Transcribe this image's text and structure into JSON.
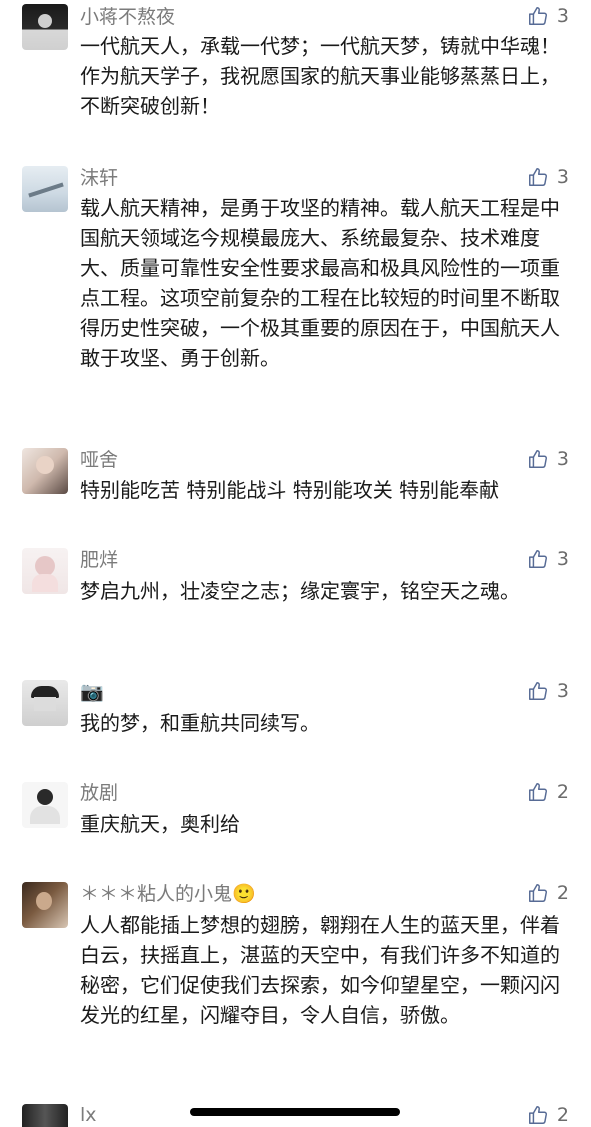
{
  "accent": "#576b95",
  "comments": [
    {
      "name": "小蒋不熬夜",
      "likes": "3",
      "text": "一代航天人，承载一代梦；一代航天梦，铸就中华魂！作为航天学子，我祝愿国家的航天事业能够蒸蒸日上，不断突破创新！"
    },
    {
      "name": "沫轩",
      "likes": "3",
      "text": "载人航天精神，是勇于攻坚的精神。载人航天工程是中国航天领域迄今规模最庞大、系统最复杂、技术难度大、质量可靠性安全性要求最高和极具风险性的一项重点工程。这项空前复杂的工程在比较短的时间里不断取得历史性突破，一个极其重要的原因在于，中国航天人敢于攻坚、勇于创新。"
    },
    {
      "name": "哑舍",
      "likes": "3",
      "text": "特别能吃苦 特别能战斗 特别能攻关 特别能奉献"
    },
    {
      "name": "肥烊",
      "likes": "3",
      "text": "梦启九州，壮凌空之志；缘定寰宇，铭空天之魂。"
    },
    {
      "name": "📷",
      "likes": "3",
      "text": "我的梦，和重航共同续写。"
    },
    {
      "name": "放剧",
      "likes": "2",
      "text": "重庆航天，奥利给"
    },
    {
      "name": "＊＊＊粘人的小鬼🙂",
      "likes": "2",
      "text": "人人都能插上梦想的翅膀，翱翔在人生的蓝天里，伴着白云，扶摇直上，湛蓝的天空中，有我们许多不知道的秘密，它们促使我们去探索，如今仰望星空，一颗闪闪发光的红星，闪耀夺目，令人自信，骄傲。"
    },
    {
      "name": "lx",
      "likes": "2",
      "text": ""
    }
  ]
}
